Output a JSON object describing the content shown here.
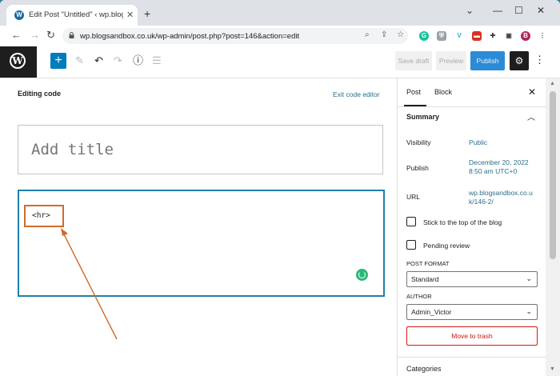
{
  "browser": {
    "tab_title": "Edit Post \"Untitled\" ‹ wp.blogsan",
    "new_tab_symbol": "+",
    "url": "wp.blogsandbox.co.uk/wp-admin/post.php?post=146&action=edit",
    "profile_initial": "B"
  },
  "icons": {
    "wordpress_logo": "wordpress-logo-icon",
    "inserter": "plus-icon",
    "tools": "pencil-icon",
    "undo": "undo-icon",
    "redo": "redo-icon",
    "details": "info-icon",
    "outline": "list-view-icon",
    "settings": "gear-icon",
    "more": "more-vertical-icon",
    "grammarly": "grammarly-icon"
  },
  "toolbar": {
    "save_draft": "Save draft",
    "preview": "Preview",
    "publish": "Publish"
  },
  "editor": {
    "editing_label": "Editing code",
    "exit_code_editor": "Exit code editor",
    "title_placeholder": "Add title",
    "code_content": "<hr>"
  },
  "sidebar": {
    "tab_post": "Post",
    "tab_block": "Block",
    "summary_heading": "Summary",
    "visibility_label": "Visibility",
    "visibility_value": "Public",
    "publish_label": "Publish",
    "publish_value_line1": "December 20, 2022",
    "publish_value_line2": "8:50 am UTC+0",
    "url_label": "URL",
    "url_value_line1": "wp.blogsandbox.co.u",
    "url_value_line2": "k/146-2/",
    "sticky_label": "Stick to the top of the blog",
    "pending_label": "Pending review",
    "post_format_caption": "POST FORMAT",
    "post_format_value": "Standard",
    "author_caption": "AUTHOR",
    "author_value": "Admin_Victor",
    "move_to_trash": "Move to trash",
    "categories": "Categories"
  },
  "colors": {
    "wp_blue": "#007cba",
    "publish_bg": "#2c8bd6",
    "annotation": "#d16b2b",
    "code_block_border": "#1f7fab",
    "link": "#2a6f8a",
    "trash": "#cc1818"
  }
}
